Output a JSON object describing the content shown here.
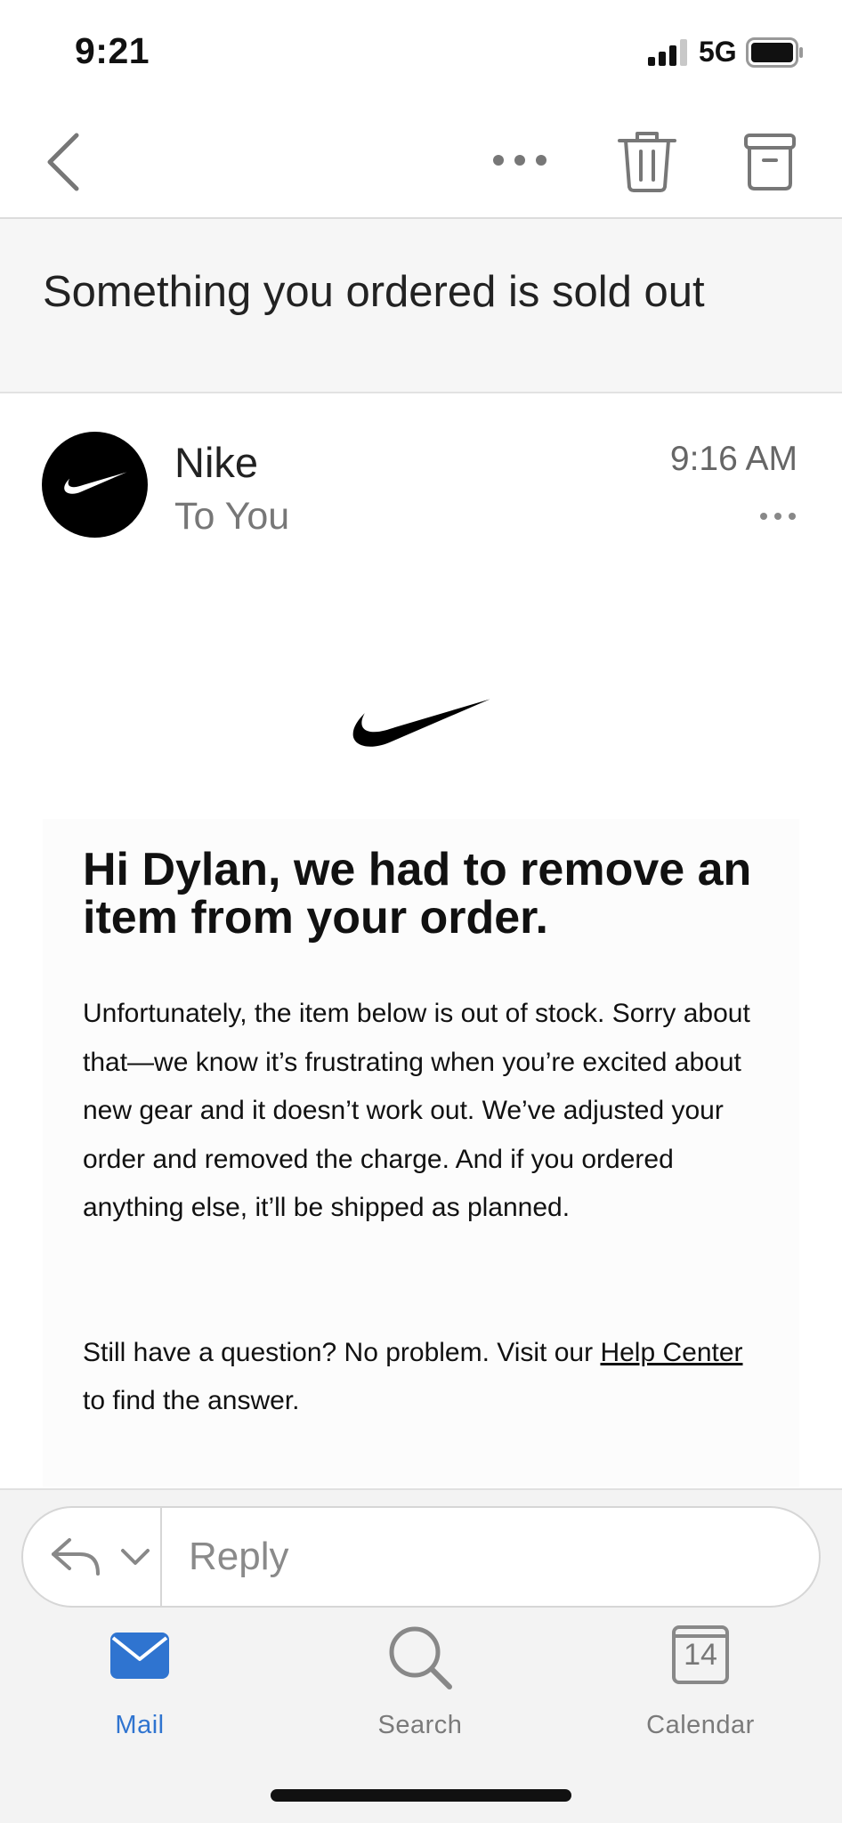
{
  "status_bar": {
    "time": "9:21",
    "network": "5G",
    "signal_icon": "cellular-signal-icon",
    "battery_icon": "battery-icon"
  },
  "nav": {
    "back_icon": "chevron-left-icon",
    "more_icon": "ellipsis-icon",
    "trash_icon": "trash-icon",
    "archive_icon": "archive-icon"
  },
  "email": {
    "subject": "Something you ordered is sold out",
    "sender": "Nike",
    "recipient": "To You",
    "time": "9:16 AM",
    "headline": "Hi Dylan, we had to remove an item from your order.",
    "paragraph_1": "Unfortunately, the item below is out of stock. Sorry about that—we know it’s frustrating when you’re excited about new gear and it doesn’t work out. We’ve adjusted your order and removed the charge. And if you ordered anything else, it’ll be shipped as planned.",
    "paragraph_2_before": "Still have a question? No problem. Visit our ",
    "help_link": "Help Center",
    "paragraph_2_after": " to find the answer."
  },
  "reply": {
    "placeholder": "Reply",
    "reply_icon": "reply-icon",
    "chevron_icon": "chevron-down-icon"
  },
  "tabs": [
    {
      "label": "Mail",
      "icon": "mail-icon",
      "active": true
    },
    {
      "label": "Search",
      "icon": "search-icon",
      "active": false
    },
    {
      "label": "Calendar",
      "icon": "calendar-icon",
      "active": false,
      "day": "14"
    }
  ],
  "colors": {
    "accent": "#2f74d0",
    "avatar_bg": "#000000",
    "subject_bg": "#f6f6f6"
  }
}
